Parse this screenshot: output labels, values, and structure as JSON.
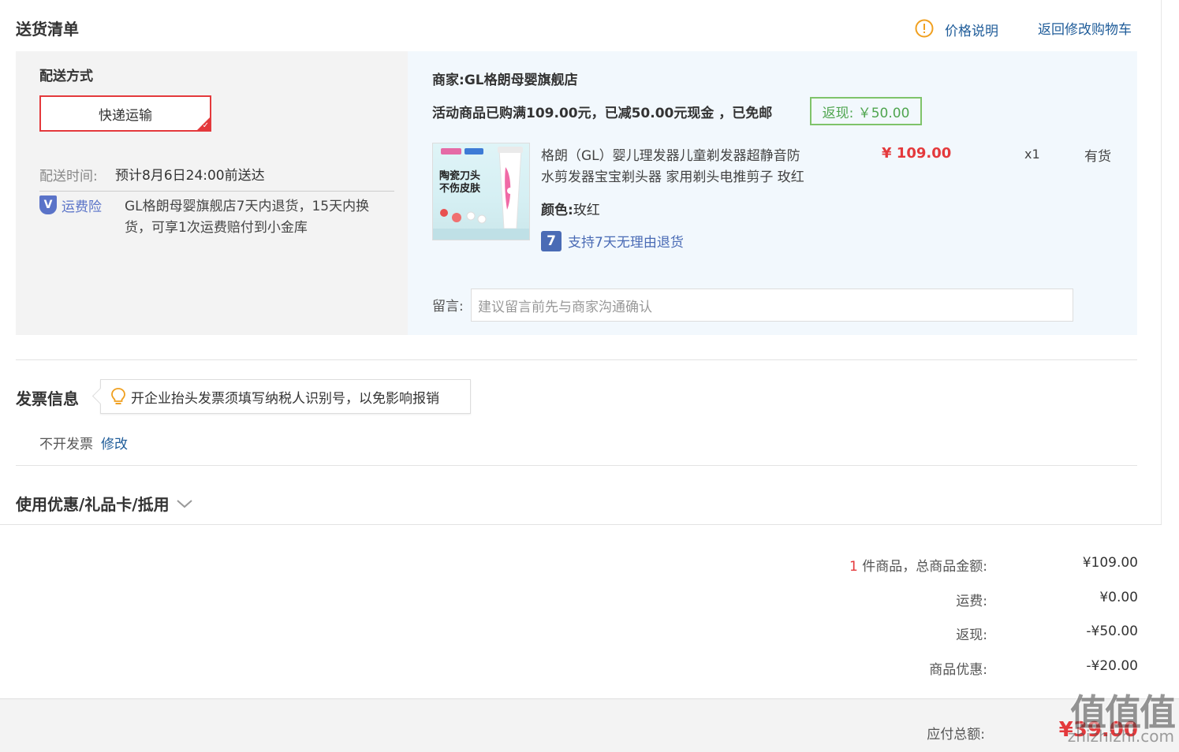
{
  "header": {
    "title": "送货清单",
    "price_note": "价格说明",
    "back_to_cart": "返回修改购物车"
  },
  "delivery": {
    "method_label": "配送方式",
    "method_value": "快递运输",
    "time_label": "配送时间:",
    "time_value": "预计8月6日24:00前送达",
    "insurance_label": "运费险",
    "insurance_text_1": "GL格朗母婴旗舰店7天内退货，15天内换",
    "insurance_text_2": "货，可享1次运费赔付到小金库"
  },
  "merchant": {
    "label": "商家:",
    "name": "GL格朗母婴旗舰店",
    "promo": "活动商品已购满109.00元，已减50.00元现金 ，已免邮",
    "cashback": "返现: ￥50.00"
  },
  "product": {
    "title_line1": "格朗（GL）婴儿理发器儿童剃发器超静音防",
    "title_line2": "水剪发器宝宝剃头器 家用剃头电推剪子 玫红",
    "price": "¥ 109.00",
    "qty": "x1",
    "stock": "有货",
    "color_label": "颜色:",
    "color_value": "玫红",
    "return_badge": "7",
    "return_text": "支持7天无理由退货",
    "image_text_1": "陶瓷刀头",
    "image_text_2": "不伤皮肤"
  },
  "message": {
    "label": "留言:",
    "placeholder": "建议留言前先与商家沟通确认"
  },
  "invoice": {
    "title": "发票信息",
    "tip": "开企业抬头发票须填写纳税人识别号，以免影响报销",
    "value": "不开发票",
    "edit": "修改"
  },
  "coupon": {
    "title": "使用优惠/礼品卡/抵用"
  },
  "summary": {
    "count": "1",
    "count_label": "件商品，总商品金额:",
    "goods_total": "¥109.00",
    "shipping_label": "运费:",
    "shipping": "¥0.00",
    "cashback_label": "返现:",
    "cashback": "-¥50.00",
    "discount_label": "商品优惠:",
    "discount": "-¥20.00",
    "payable_label": "应付总额:",
    "payable": "¥39.00"
  },
  "watermark": {
    "main": "值值值",
    "sub": "zhizhizhi.com"
  },
  "colors": {
    "accent_red": "#e4393c",
    "link_blue": "#1f5c99",
    "cashback_green": "#4fa54f",
    "warning_orange": "#f0a020"
  }
}
